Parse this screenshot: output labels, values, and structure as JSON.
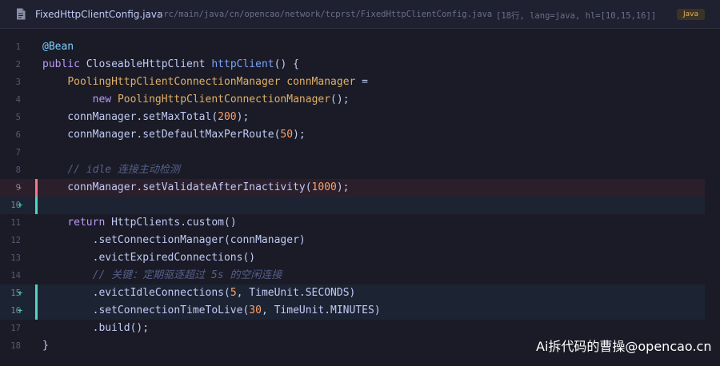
{
  "header": {
    "file_name": "FixedHttpClientConfig.java",
    "file_path": "src/main/java/cn/opencao/network/tcprst/FixedHttpClientConfig.java",
    "meta": "[18行, lang=java, hl=[10,15,16]]",
    "language": "Java",
    "icon": "file-icon"
  },
  "colors": {
    "background": "#1a1b26",
    "deleted_line": "#f7768e",
    "added_line": "#4fd6be",
    "keyword": "#bb9af7",
    "type": "#e0af68",
    "number": "#ff9e64",
    "comment": "#565f89",
    "annotation": "#7dcfff"
  },
  "lines": [
    {
      "n": "1",
      "mark": "",
      "status": "",
      "tokens": [
        {
          "t": "@Bean",
          "c": "ann"
        }
      ]
    },
    {
      "n": "2",
      "mark": "",
      "status": "",
      "tokens": [
        {
          "t": "public",
          "c": "kw"
        },
        {
          "t": " CloseableHttpClient ",
          "c": "plain"
        },
        {
          "t": "httpClient",
          "c": "fn"
        },
        {
          "t": "() {",
          "c": "plain"
        }
      ]
    },
    {
      "n": "3",
      "mark": "",
      "status": "",
      "tokens": [
        {
          "t": "    ",
          "c": "plain"
        },
        {
          "t": "PoolingHttpClientConnectionManager",
          "c": "type"
        },
        {
          "t": " ",
          "c": "plain"
        },
        {
          "t": "connManager",
          "c": "type"
        },
        {
          "t": " =",
          "c": "plain"
        }
      ]
    },
    {
      "n": "4",
      "mark": "",
      "status": "",
      "tokens": [
        {
          "t": "        ",
          "c": "plain"
        },
        {
          "t": "new",
          "c": "kw"
        },
        {
          "t": " ",
          "c": "plain"
        },
        {
          "t": "PoolingHttpClientConnectionManager",
          "c": "type"
        },
        {
          "t": "();",
          "c": "plain"
        }
      ]
    },
    {
      "n": "5",
      "mark": "",
      "status": "",
      "tokens": [
        {
          "t": "    connManager.setMaxTotal(",
          "c": "plain"
        },
        {
          "t": "200",
          "c": "num"
        },
        {
          "t": ");",
          "c": "plain"
        }
      ]
    },
    {
      "n": "6",
      "mark": "",
      "status": "",
      "tokens": [
        {
          "t": "    connManager.setDefaultMaxPerRoute(",
          "c": "plain"
        },
        {
          "t": "50",
          "c": "num"
        },
        {
          "t": ");",
          "c": "plain"
        }
      ]
    },
    {
      "n": "7",
      "mark": "",
      "status": "",
      "tokens": []
    },
    {
      "n": "8",
      "mark": "",
      "status": "",
      "tokens": [
        {
          "t": "    ",
          "c": "plain"
        },
        {
          "t": "// idle 连接主动检测",
          "c": "com"
        }
      ]
    },
    {
      "n": "9",
      "mark": "-",
      "status": "del",
      "tokens": [
        {
          "t": "    connManager.setValidateAfterInactivity(",
          "c": "plain"
        },
        {
          "t": "1000",
          "c": "num"
        },
        {
          "t": ");",
          "c": "plain"
        }
      ]
    },
    {
      "n": "10",
      "mark": "+",
      "status": "add",
      "tokens": []
    },
    {
      "n": "11",
      "mark": "",
      "status": "",
      "tokens": [
        {
          "t": "    ",
          "c": "plain"
        },
        {
          "t": "return",
          "c": "kw"
        },
        {
          "t": " HttpClients.custom()",
          "c": "plain"
        }
      ]
    },
    {
      "n": "12",
      "mark": "",
      "status": "",
      "tokens": [
        {
          "t": "        .setConnectionManager(connManager)",
          "c": "plain"
        }
      ]
    },
    {
      "n": "13",
      "mark": "",
      "status": "",
      "tokens": [
        {
          "t": "        .evictExpiredConnections()",
          "c": "plain"
        }
      ]
    },
    {
      "n": "14",
      "mark": "",
      "status": "",
      "tokens": [
        {
          "t": "        ",
          "c": "plain"
        },
        {
          "t": "// 关键：定期驱逐超过 5s 的空闲连接",
          "c": "com"
        }
      ]
    },
    {
      "n": "15",
      "mark": "+",
      "status": "add",
      "tokens": [
        {
          "t": "        .evictIdleConnections(",
          "c": "plain"
        },
        {
          "t": "5",
          "c": "num"
        },
        {
          "t": ", TimeUnit.SECONDS)",
          "c": "plain"
        }
      ]
    },
    {
      "n": "16",
      "mark": "+",
      "status": "add",
      "tokens": [
        {
          "t": "        .setConnectionTimeToLive(",
          "c": "plain"
        },
        {
          "t": "30",
          "c": "num"
        },
        {
          "t": ", TimeUnit.MINUTES)",
          "c": "plain"
        }
      ]
    },
    {
      "n": "17",
      "mark": "",
      "status": "",
      "tokens": [
        {
          "t": "        .build();",
          "c": "plain"
        }
      ]
    },
    {
      "n": "18",
      "mark": "",
      "status": "",
      "tokens": [
        {
          "t": "}",
          "c": "plain"
        }
      ]
    }
  ],
  "watermark": "Ai拆代码的曹操@opencao.cn"
}
